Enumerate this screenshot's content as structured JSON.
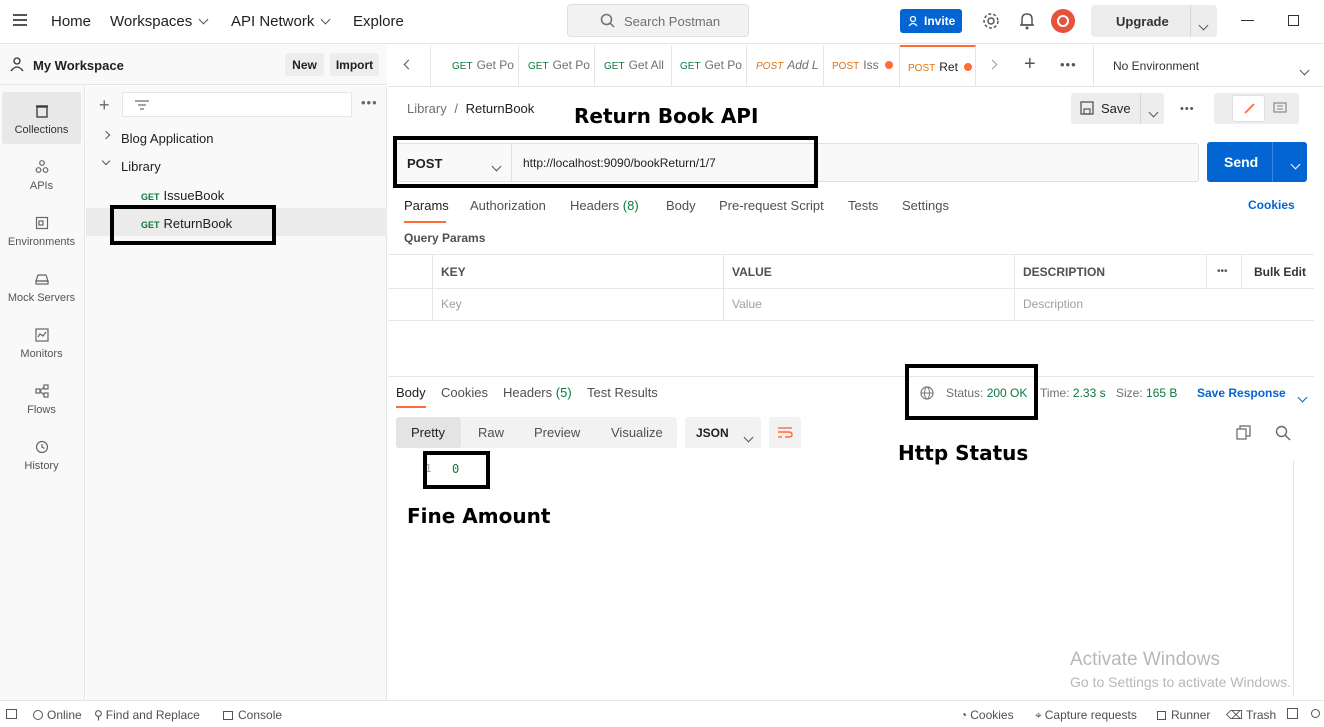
{
  "topbar": {
    "home": "Home",
    "workspaces": "Workspaces",
    "api_network": "API Network",
    "explore": "Explore",
    "search_placeholder": "Search Postman",
    "invite": "Invite",
    "upgrade": "Upgrade"
  },
  "sidebar": {
    "workspace": "My Workspace",
    "new": "New",
    "import": "Import",
    "rail": [
      {
        "label": "Collections"
      },
      {
        "label": "APIs"
      },
      {
        "label": "Environments"
      },
      {
        "label": "Mock Servers"
      },
      {
        "label": "Monitors"
      },
      {
        "label": "Flows"
      },
      {
        "label": "History"
      }
    ],
    "collections": [
      {
        "label": "Blog Application"
      },
      {
        "label": "Library"
      }
    ],
    "requests": [
      {
        "method": "GET",
        "label": "IssueBook"
      },
      {
        "method": "GET",
        "label": "ReturnBook"
      }
    ]
  },
  "tabs": [
    {
      "method": "GET",
      "label": "Get Po"
    },
    {
      "method": "GET",
      "label": "Get Po"
    },
    {
      "method": "GET",
      "label": "Get All"
    },
    {
      "method": "GET",
      "label": "Get Po"
    },
    {
      "method": "POST",
      "label": "Add L"
    },
    {
      "method": "POST",
      "label": "Iss"
    },
    {
      "method": "POST",
      "label": "Ret"
    }
  ],
  "environment": "No Environment",
  "breadcrumb": {
    "parent": "Library",
    "sep": "/",
    "current": "ReturnBook"
  },
  "save": "Save",
  "request": {
    "method": "POST",
    "url": "http://localhost:9090/bookReturn/1/7",
    "send": "Send"
  },
  "request_tabs": [
    "Params",
    "Authorization",
    "Headers",
    "Body",
    "Pre-request Script",
    "Tests",
    "Settings"
  ],
  "headers_count": "(8)",
  "cookies": "Cookies",
  "query_params": "Query Params",
  "params_table": {
    "headers": [
      "KEY",
      "VALUE",
      "DESCRIPTION"
    ],
    "placeholders": [
      "Key",
      "Value",
      "Description"
    ],
    "bulk_edit": "Bulk Edit"
  },
  "response": {
    "tabs": [
      "Body",
      "Cookies",
      "Headers",
      "Test Results"
    ],
    "headers_count": "(5)",
    "status_label": "Status:",
    "status": "200 OK",
    "time_label": "Time:",
    "time": "2.33 s",
    "size_label": "Size:",
    "size": "165 B",
    "save_response": "Save Response",
    "view_tabs": [
      "Pretty",
      "Raw",
      "Preview",
      "Visualize"
    ],
    "format": "JSON",
    "line_no": "1",
    "body": "0"
  },
  "annotations": {
    "api": "Return Book API",
    "status": "Http Status",
    "fine": "Fine Amount"
  },
  "watermark": {
    "title": "Activate Windows",
    "sub": "Go to Settings to activate Windows."
  },
  "statusbar": {
    "online": "Online",
    "find": "Find and Replace",
    "console": "Console",
    "cookies": "Cookies",
    "capture": "Capture requests",
    "runner": "Runner",
    "trash": "Trash"
  },
  "colors": {
    "accent": "#ff6c37",
    "send": "#0265d2",
    "ok": "#0a7a3c"
  }
}
